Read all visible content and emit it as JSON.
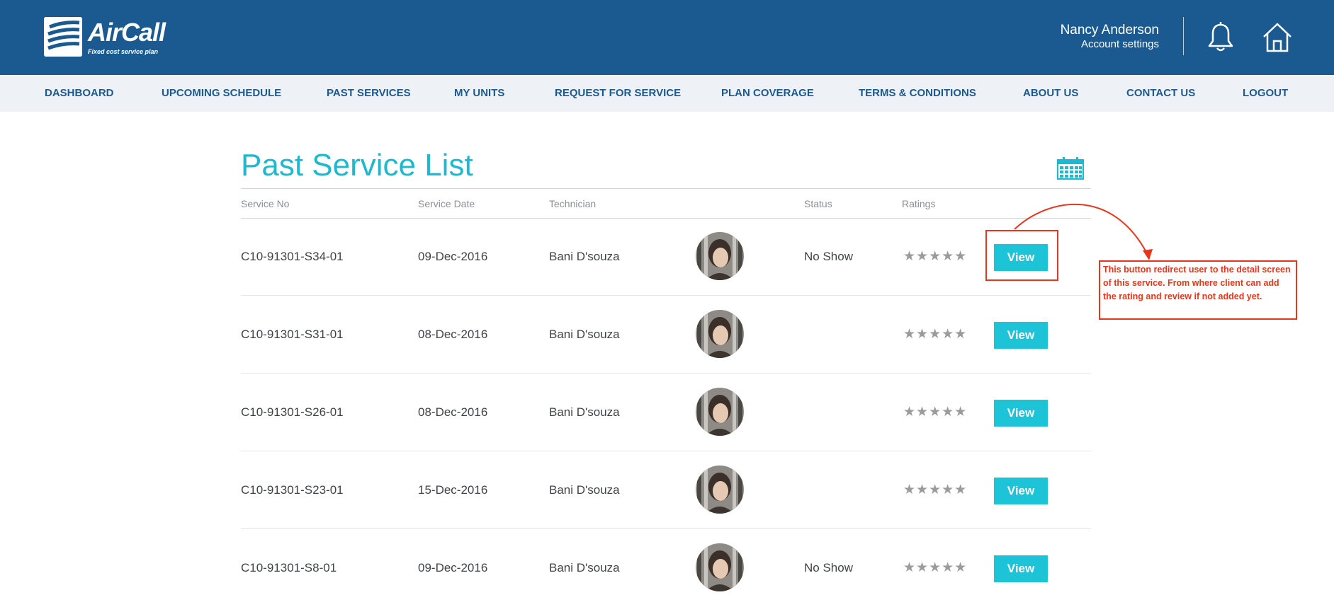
{
  "app": {
    "logo_text": "AirCall",
    "tagline": "Fixed cost service plan"
  },
  "header": {
    "user_name": "Nancy Anderson",
    "account_link": "Account settings",
    "icons": [
      "bell-icon",
      "home-icon"
    ]
  },
  "nav": {
    "items": [
      {
        "label": "DASHBOARD"
      },
      {
        "label": "UPCOMING SCHEDULE"
      },
      {
        "label": "PAST SERVICES"
      },
      {
        "label": "MY UNITS"
      },
      {
        "label": "REQUEST FOR SERVICE"
      },
      {
        "label": "PLAN COVERAGE"
      },
      {
        "label": "TERMS & CONDITIONS"
      },
      {
        "label": "ABOUT US"
      },
      {
        "label": "CONTACT US"
      },
      {
        "label": "LOGOUT"
      }
    ]
  },
  "main": {
    "title": "Past Service List",
    "calendar_icon": "calendar-icon",
    "columns": [
      "Service No",
      "Service Date",
      "Technician",
      "Status",
      "Ratings"
    ],
    "rows": [
      {
        "service_no": "C10-91301-S34-01",
        "date": "09-Dec-2016",
        "technician": "Bani D'souza",
        "status": "No Show",
        "rating": 0,
        "stars": "★★★★★",
        "action": "View"
      },
      {
        "service_no": "C10-91301-S31-01",
        "date": "08-Dec-2016",
        "technician": "Bani D'souza",
        "status": "",
        "rating": 0,
        "stars": "★★★★★",
        "action": "View"
      },
      {
        "service_no": "C10-91301-S26-01",
        "date": "08-Dec-2016",
        "technician": "Bani D'souza",
        "status": "",
        "rating": 0,
        "stars": "★★★★★",
        "action": "View"
      },
      {
        "service_no": "C10-91301-S23-01",
        "date": "15-Dec-2016",
        "technician": "Bani D'souza",
        "status": "",
        "rating": 0,
        "stars": "★★★★★",
        "action": "View"
      },
      {
        "service_no": "C10-91301-S8-01",
        "date": "09-Dec-2016",
        "technician": "Bani D'souza",
        "status": "No Show",
        "rating": 0,
        "stars": "★★★★★",
        "action": "View"
      }
    ]
  },
  "annotation": {
    "note": "This button redirect user to the detail screen of this service. From where client can add the rating and review if not added yet."
  },
  "colors": {
    "header_bg": "#1b5a91",
    "nav_bg": "#eef2f6",
    "nav_text": "#1b5a91",
    "accent": "#1dc4d8",
    "title": "#1fb9cf",
    "annotation": "#e8361c",
    "star": "#9b9b9b"
  }
}
